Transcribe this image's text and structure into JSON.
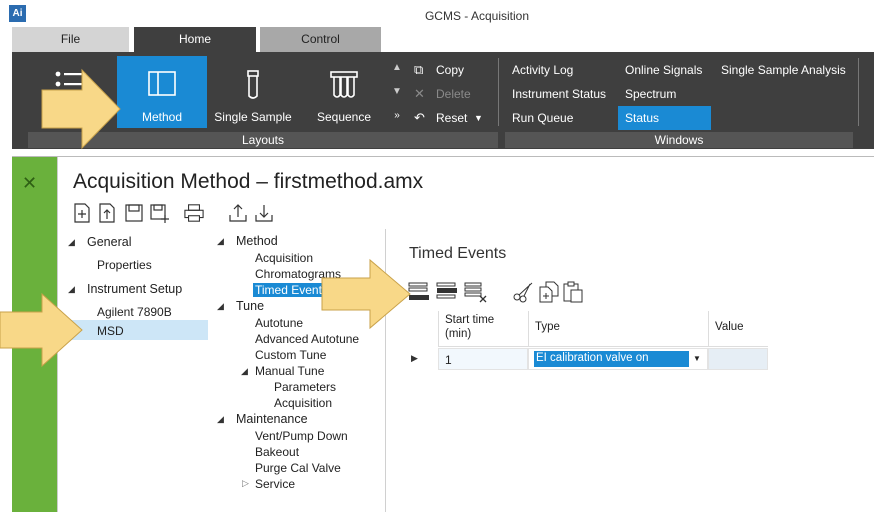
{
  "app": {
    "icon_text": "Ai",
    "title": "GCMS - Acquisition"
  },
  "ribbon": {
    "tabs": [
      {
        "label": "File"
      },
      {
        "label": "Home"
      },
      {
        "label": "Control"
      }
    ],
    "layouts": {
      "buttons": [
        {
          "label": "Method"
        },
        {
          "label": "Single Sample"
        },
        {
          "label": "Sequence"
        }
      ],
      "group_label": "Layouts"
    },
    "edit": {
      "copy": "Copy",
      "delete": "Delete",
      "reset": "Reset"
    },
    "windows": {
      "col1": [
        "Activity Log",
        "Instrument Status",
        "Run Queue"
      ],
      "col2": [
        "Online Signals",
        "Spectrum",
        "Status"
      ],
      "col3": [
        "Single Sample Analysis"
      ],
      "group_label": "Windows"
    }
  },
  "page": {
    "title": "Acquisition Method – firstmethod.amx"
  },
  "left_tree": {
    "general": "General",
    "properties": "Properties",
    "instrument_setup": "Instrument Setup",
    "agilent": "Agilent 7890B",
    "msd": "MSD"
  },
  "mid_tree": {
    "method": "Method",
    "acquisition": "Acquisition",
    "chromatograms": "Chromatograms",
    "timed_events": "Timed Events",
    "tune": "Tune",
    "autotune": "Autotune",
    "advanced_autotune": "Advanced Autotune",
    "custom_tune": "Custom Tune",
    "manual_tune": "Manual Tune",
    "parameters": "Parameters",
    "acquisition2": "Acquisition",
    "maintenance": "Maintenance",
    "vent": "Vent/Pump Down",
    "bakeout": "Bakeout",
    "purge": "Purge Cal Valve",
    "service": "Service"
  },
  "timed_events": {
    "title": "Timed Events",
    "columns": {
      "start": "Start time\n(min)",
      "type": "Type",
      "value": "Value"
    },
    "rows": [
      {
        "start": "1",
        "type": "EI calibration valve on",
        "value": ""
      }
    ]
  },
  "colors": {
    "accent": "#1a8ad4",
    "ribbon": "#3f3f3f",
    "green": "#6ab13c",
    "arrow": "#f8d888"
  }
}
